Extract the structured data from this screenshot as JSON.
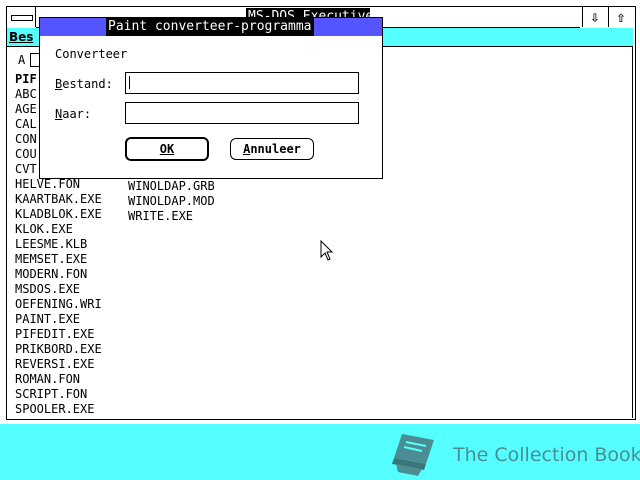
{
  "window": {
    "title": "MS-DOS Executive",
    "menu": {
      "file_label": "Bes"
    }
  },
  "drives": {
    "a_label": "A"
  },
  "path_label": "PIF",
  "files": {
    "col1": [
      "ABC",
      "AGE",
      "CAL",
      "CON",
      "COU",
      "CVT",
      "HELVE.FON",
      "KAARTBAK.EXE",
      "KLADBLOK.EXE",
      "KLOK.EXE",
      "LEESME.KLB",
      "MEMSET.EXE",
      "MODERN.FON",
      "MSDOS.EXE",
      "OEFENING.WRI",
      "PAINT.EXE",
      "PIFEDIT.EXE",
      "PRIKBORD.EXE",
      "REVERSI.EXE",
      "ROMAN.FON",
      "SCRIPT.FON",
      "SPOOLER.EXE"
    ],
    "col2": [
      "WINOLDAP.GRB",
      "WINOLDAP.MOD",
      "WRITE.EXE"
    ]
  },
  "dialog": {
    "title": "Paint converteer-programma",
    "heading": "Converteer",
    "source_label": "Bestand:",
    "source_value": "",
    "target_label": "Naar:",
    "target_value": "",
    "ok_label": "OK",
    "cancel_label": "Annuleer"
  },
  "icons": {
    "system_menu": "system-menu-icon",
    "minimize": "arrow-down-icon",
    "maximize": "arrow-up-icon",
    "cursor": "mouse-pointer-icon",
    "watermark": "book-icon"
  },
  "watermark": {
    "text": "The Collection Book"
  },
  "colors": {
    "desktop": "#55FFFF",
    "dialog_titlebar": "#5555FF",
    "title_highlight": "#000000",
    "watermark": "#4A8E93"
  }
}
